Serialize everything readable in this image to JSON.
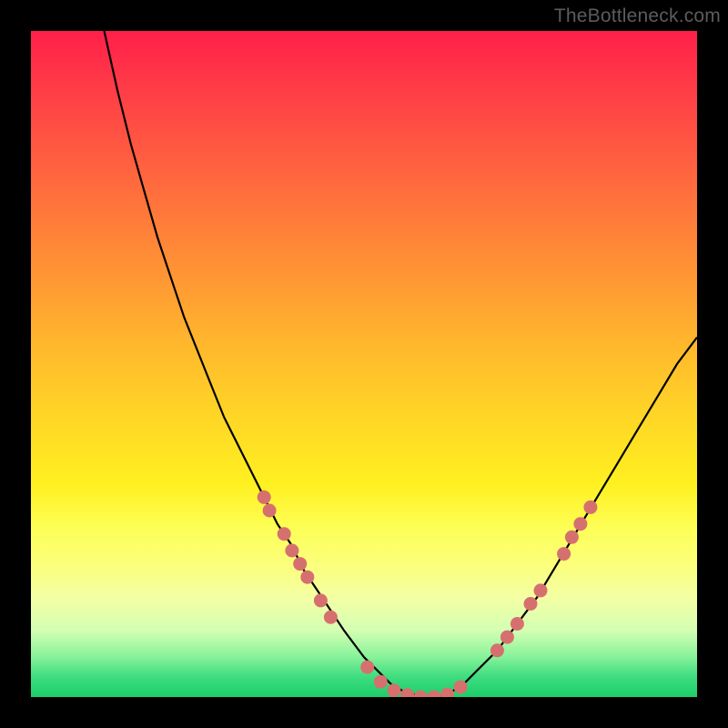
{
  "watermark": "TheBottleneck.com",
  "colors": {
    "frame": "#000000",
    "curve": "#000000",
    "marker_fill": "#d6706f",
    "marker_stroke": "#c45a59"
  },
  "chart_data": {
    "type": "line",
    "title": "",
    "xlabel": "",
    "ylabel": "",
    "xlim": [
      0,
      100
    ],
    "ylim": [
      0,
      100
    ],
    "series": [
      {
        "name": "curve",
        "x": [
          11,
          13,
          15,
          17,
          19,
          21,
          23,
          25,
          27,
          29,
          31,
          33,
          35,
          37,
          39,
          41,
          43,
          45,
          47,
          50,
          52,
          54,
          56,
          59,
          61,
          63,
          65,
          67,
          70,
          73,
          76,
          79,
          82,
          85,
          88,
          91,
          94,
          97,
          100
        ],
        "y": [
          100,
          91,
          83,
          76,
          69,
          63,
          57,
          52,
          47,
          42,
          38,
          34,
          30,
          26,
          23,
          19,
          16,
          13,
          10,
          6,
          4,
          2,
          0.8,
          0,
          0,
          0.7,
          2,
          4,
          7,
          11,
          15,
          20,
          25,
          30,
          35,
          40,
          45,
          50,
          54
        ]
      }
    ],
    "markers": [
      {
        "x": 35.0,
        "y": 30
      },
      {
        "x": 35.8,
        "y": 28
      },
      {
        "x": 38.0,
        "y": 24.5
      },
      {
        "x": 39.2,
        "y": 22
      },
      {
        "x": 40.4,
        "y": 20
      },
      {
        "x": 41.5,
        "y": 18
      },
      {
        "x": 43.5,
        "y": 14.5
      },
      {
        "x": 45.0,
        "y": 12
      },
      {
        "x": 50.5,
        "y": 4.5
      },
      {
        "x": 52.5,
        "y": 2.3
      },
      {
        "x": 54.5,
        "y": 1.0
      },
      {
        "x": 56.5,
        "y": 0.3
      },
      {
        "x": 58.5,
        "y": 0.0
      },
      {
        "x": 60.5,
        "y": 0.0
      },
      {
        "x": 62.5,
        "y": 0.4
      },
      {
        "x": 64.5,
        "y": 1.5
      },
      {
        "x": 70.0,
        "y": 7.0
      },
      {
        "x": 71.5,
        "y": 9.0
      },
      {
        "x": 73.0,
        "y": 11.0
      },
      {
        "x": 75.0,
        "y": 14.0
      },
      {
        "x": 76.5,
        "y": 16.0
      },
      {
        "x": 80.0,
        "y": 21.5
      },
      {
        "x": 81.2,
        "y": 24.0
      },
      {
        "x": 82.5,
        "y": 26.0
      },
      {
        "x": 84.0,
        "y": 28.5
      }
    ],
    "marker_radius_px": 7.5
  }
}
